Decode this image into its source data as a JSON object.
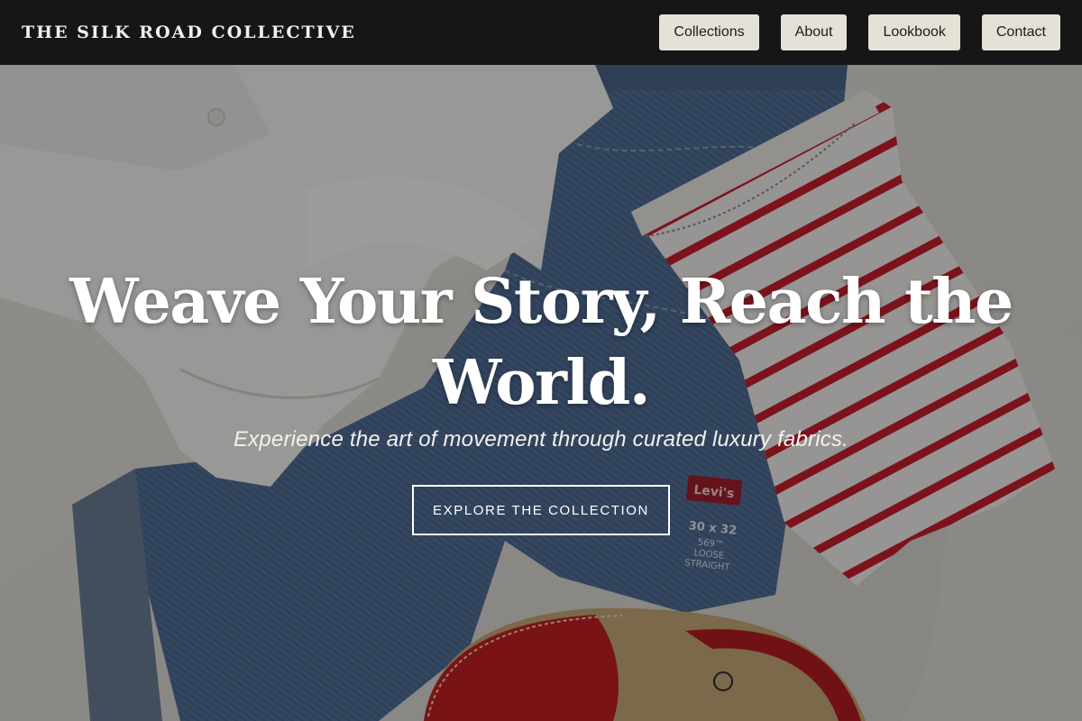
{
  "brand": {
    "name": "THE SILK ROAD COLLECTIVE"
  },
  "nav": {
    "items": [
      {
        "label": "Collections"
      },
      {
        "label": "About"
      },
      {
        "label": "Lookbook"
      },
      {
        "label": "Contact"
      }
    ]
  },
  "hero": {
    "headline": "Weave Your Story, Reach the World.",
    "tagline": "Experience the art of movement through curated luxury fabrics.",
    "cta_label": "EXPLORE THE COLLECTION",
    "image_labels": {
      "brand_tag": "Levi's",
      "size_text": "30 x 32",
      "fit_line1": "569™",
      "fit_line2": "LOOSE",
      "fit_line3": "STRAIGHT"
    }
  },
  "colors": {
    "navbar_bg": "#161616",
    "nav_button_bg": "#e4e1d7",
    "stripe_red": "#c8202e",
    "denim": "#4f6f99",
    "sandal_red": "#c41f24"
  }
}
